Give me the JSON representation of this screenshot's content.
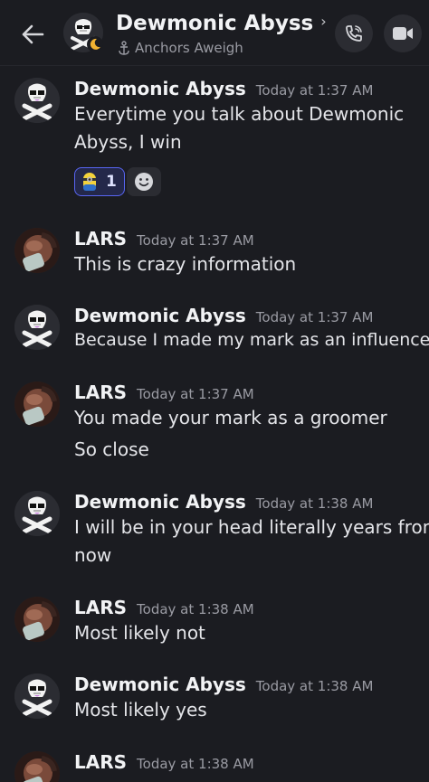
{
  "header": {
    "title": "Dewmonic Abyss",
    "chevron": "›",
    "subtitle": "Anchors Aweigh",
    "back_icon": "arrow-left-icon",
    "call_icon": "phone-call-icon",
    "video_icon": "video-camera-icon"
  },
  "colors": {
    "background": "#1b1c21",
    "reaction_border": "#5865f2",
    "reaction_bg": "#24284a",
    "timestamp": "#9a9ba3"
  },
  "messages": [
    {
      "author": "Dewmonic Abyss",
      "time": "Today at 1:37 AM",
      "lines": [
        "Everytime you talk about Dewmonic",
        "Abyss, I win"
      ],
      "reaction": {
        "emoji": "minion-emoji",
        "count": "1"
      }
    },
    {
      "author": "LARS",
      "time": "Today at 1:37 AM",
      "lines": [
        "This is crazy information"
      ]
    },
    {
      "author": "Dewmonic Abyss",
      "time": "Today at 1:37 AM",
      "lines": [
        "Because I made my mark as an influencer"
      ]
    },
    {
      "author": "LARS",
      "time": "Today at 1:37 AM",
      "lines": [
        "You made your mark as a groomer",
        "So close"
      ]
    },
    {
      "author": "Dewmonic Abyss",
      "time": "Today at 1:38 AM",
      "lines": [
        "I will be in your head literally years from",
        "now"
      ]
    },
    {
      "author": "LARS",
      "time": "Today at 1:38 AM",
      "lines": [
        "Most likely not"
      ]
    },
    {
      "author": "Dewmonic Abyss",
      "time": "Today at 1:38 AM",
      "lines": [
        "Most likely yes"
      ]
    },
    {
      "author": "LARS",
      "time": "Today at 1:38 AM",
      "lines": []
    }
  ]
}
